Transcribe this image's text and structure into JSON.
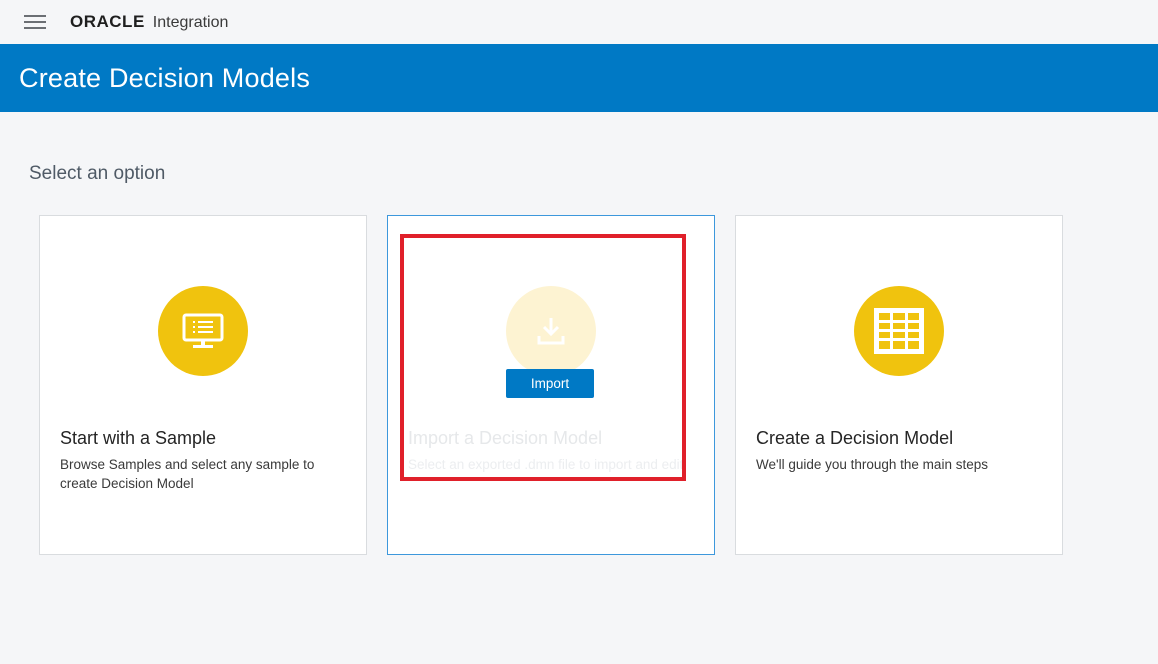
{
  "header": {
    "logo_text": "ORACLE",
    "product_name": "Integration"
  },
  "banner": {
    "title": "Create Decision Models"
  },
  "main": {
    "subtitle": "Select an option",
    "cards": [
      {
        "icon": "monitor-list-icon",
        "title": "Start with a Sample",
        "description": "Browse Samples and select any sample to create Decision Model"
      },
      {
        "icon": "download-icon",
        "title": "Import a Decision Model",
        "description": "Select an exported .dmn file to import and edit",
        "button_label": "Import"
      },
      {
        "icon": "table-grid-icon",
        "title": "Create a Decision Model",
        "description": "We'll guide you through the main steps"
      }
    ]
  },
  "colors": {
    "brand_blue": "#0079c5",
    "icon_yellow": "#f0c30e",
    "highlight_red": "#e0202a"
  }
}
